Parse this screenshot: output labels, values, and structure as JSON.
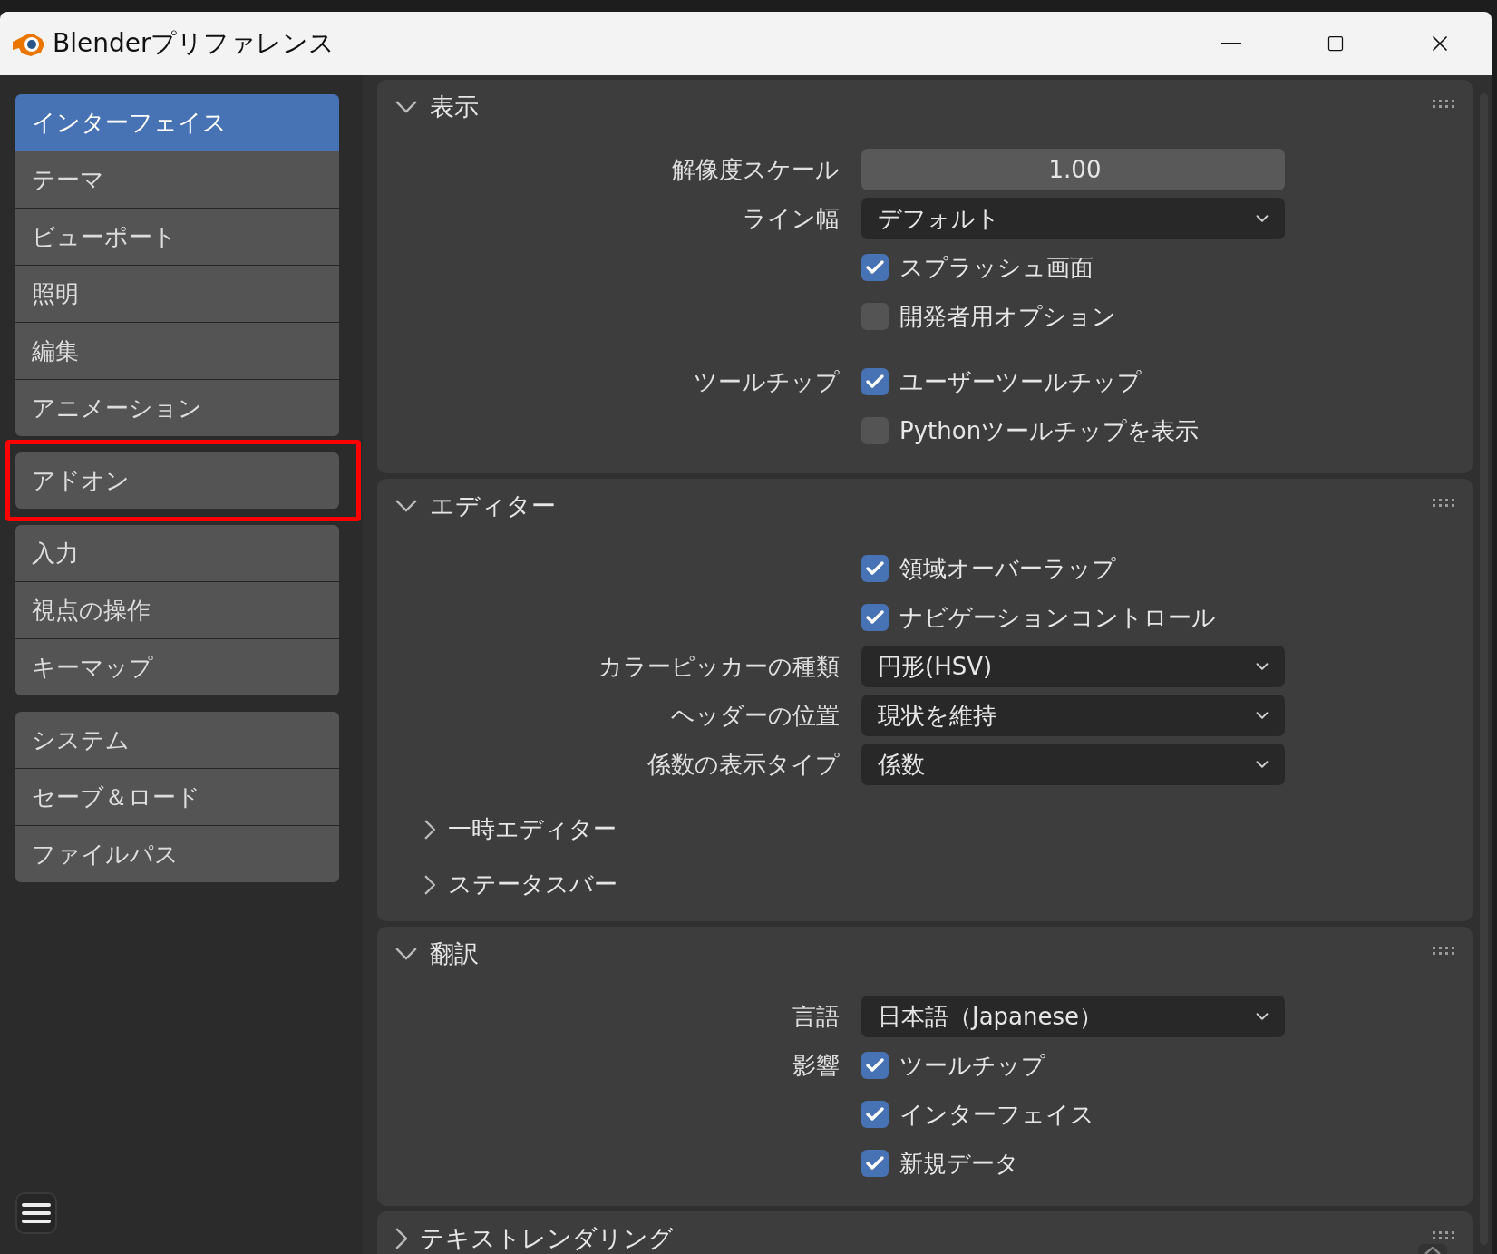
{
  "window": {
    "title": "Blenderプリファレンス"
  },
  "sidebar": {
    "groups": [
      {
        "outlined": false,
        "items": [
          {
            "label": "インターフェイス",
            "selected": true
          },
          {
            "label": "テーマ",
            "selected": false
          },
          {
            "label": "ビューポート",
            "selected": false
          },
          {
            "label": "照明",
            "selected": false
          },
          {
            "label": "編集",
            "selected": false
          },
          {
            "label": "アニメーション",
            "selected": false
          }
        ]
      },
      {
        "outlined": true,
        "items": [
          {
            "label": "アドオン",
            "selected": false
          }
        ]
      },
      {
        "outlined": false,
        "items": [
          {
            "label": "入力",
            "selected": false
          },
          {
            "label": "視点の操作",
            "selected": false
          },
          {
            "label": "キーマップ",
            "selected": false
          }
        ]
      },
      {
        "outlined": false,
        "items": [
          {
            "label": "システム",
            "selected": false
          },
          {
            "label": "セーブ＆ロード",
            "selected": false
          },
          {
            "label": "ファイルパス",
            "selected": false
          }
        ]
      }
    ]
  },
  "sections": [
    {
      "title": "表示",
      "expanded": true,
      "groups": [
        [
          {
            "kind": "number",
            "label": "解像度スケール",
            "value": "1.00"
          },
          {
            "kind": "dropdown",
            "label": "ライン幅",
            "value": "デフォルト"
          },
          {
            "kind": "checkbox",
            "text": "スプラッシュ画面",
            "checked": true
          },
          {
            "kind": "checkbox",
            "text": "開発者用オプション",
            "checked": false
          }
        ],
        [
          {
            "kind": "checkbox",
            "label": "ツールチップ",
            "text": "ユーザーツールチップ",
            "checked": true
          },
          {
            "kind": "checkbox",
            "text": "Pythonツールチップを表示",
            "checked": false
          }
        ]
      ]
    },
    {
      "title": "エディター",
      "expanded": true,
      "groups": [
        [
          {
            "kind": "checkbox",
            "text": "領域オーバーラップ",
            "checked": true
          },
          {
            "kind": "checkbox",
            "text": "ナビゲーションコントロール",
            "checked": true
          },
          {
            "kind": "dropdown",
            "label": "カラーピッカーの種類",
            "value": "円形(HSV)"
          },
          {
            "kind": "dropdown",
            "label": "ヘッダーの位置",
            "value": "現状を維持"
          },
          {
            "kind": "dropdown",
            "label": "係数の表示タイプ",
            "value": "係数"
          }
        ],
        [
          {
            "kind": "subpanel",
            "text": "一時エディター",
            "expanded": false
          },
          {
            "kind": "subpanel",
            "text": "ステータスバー",
            "expanded": false
          }
        ]
      ]
    },
    {
      "title": "翻訳",
      "expanded": true,
      "groups": [
        [
          {
            "kind": "dropdown",
            "label": "言語",
            "value": "日本語（Japanese）"
          },
          {
            "kind": "checkbox",
            "label": "影響",
            "text": "ツールチップ",
            "checked": true
          },
          {
            "kind": "checkbox",
            "text": "インターフェイス",
            "checked": true
          },
          {
            "kind": "checkbox",
            "text": "新規データ",
            "checked": true
          }
        ]
      ]
    },
    {
      "title": "テキストレンダリング",
      "expanded": false
    }
  ]
}
